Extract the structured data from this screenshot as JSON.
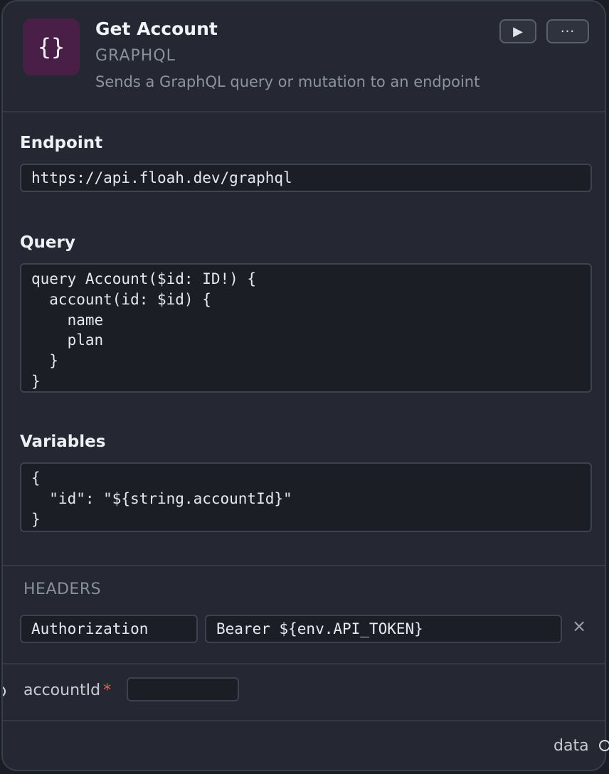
{
  "node": {
    "icon": "braces-icon",
    "icon_glyph": "{}",
    "title": "Get Account",
    "kind": "GRAPHQL",
    "description": "Sends a GraphQL query or mutation to an endpoint",
    "run_glyph": "▶",
    "more_glyph": "···"
  },
  "fields": {
    "endpoint_label": "Endpoint",
    "endpoint_value": "https://api.floah.dev/graphql",
    "query_label": "Query",
    "query_value": "query Account($id: ID!) {\n  account(id: $id) {\n    name\n    plan\n  }\n}",
    "variables_label": "Variables",
    "variables_value": "{\n  \"id\": \"${string.accountId}\"\n}"
  },
  "headers": {
    "title": "HEADERS",
    "rows": [
      {
        "key": "Authorization",
        "value": "Bearer ${env.API_TOKEN}",
        "remove_glyph": "×"
      }
    ]
  },
  "inputs": [
    {
      "name": "accountId",
      "required_mark": "*",
      "value": ""
    }
  ],
  "outputs": [
    {
      "name": "data"
    }
  ],
  "colors": {
    "icon_bg": "#4a1f47",
    "card_bg": "#252832",
    "field_bg": "#1c1e26",
    "required": "#e0605a"
  }
}
